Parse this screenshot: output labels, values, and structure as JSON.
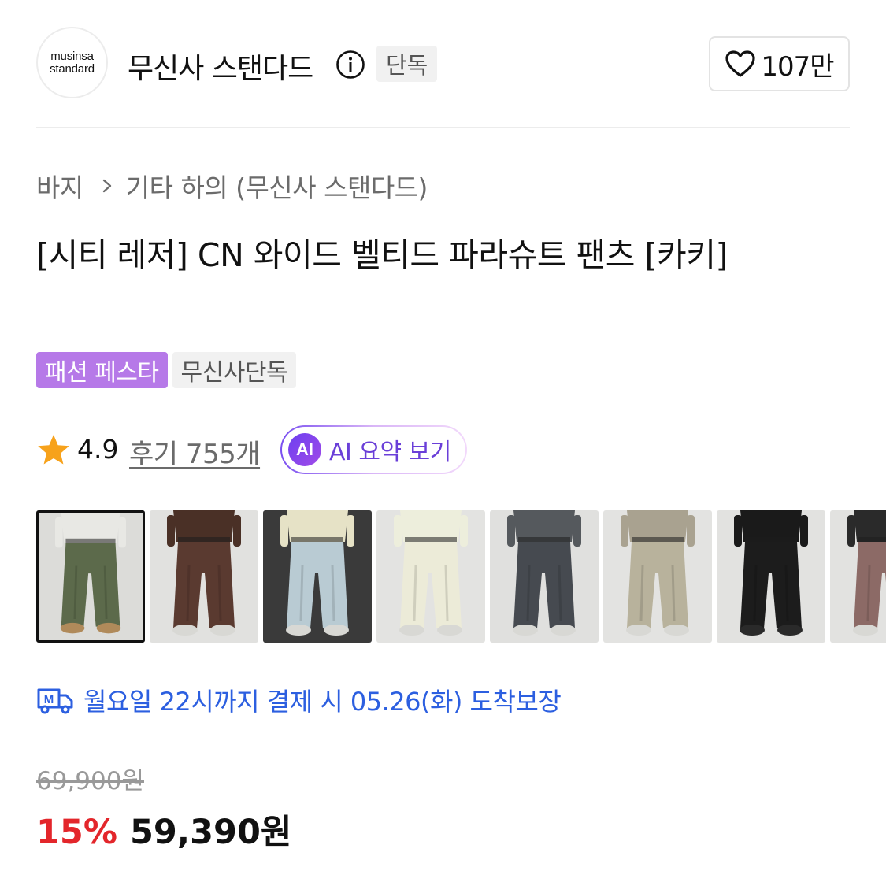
{
  "brand": {
    "logo_line1": "musinsa",
    "logo_line2": "standard",
    "name": "무신사 스탠다드",
    "exclusive_chip": "단독",
    "likes": "107만"
  },
  "breadcrumb": {
    "category": "바지",
    "subcategory": "기타 하의 (무신사 스탠다드)"
  },
  "product": {
    "title": "[시티 레저] CN 와이드 벨티드 파라슈트 팬츠 [카키]",
    "tags": [
      "패션 페스타",
      "무신사단독"
    ],
    "rating": "4.9",
    "reviews": "후기 755개",
    "ai_badge": "AI",
    "ai_summary_label": "AI 요약 보기"
  },
  "thumbnails": [
    {
      "name": "khaki",
      "pants_color": "#5c6a4b",
      "top_color": "#e8e8e4",
      "bg": "#dcdcd9",
      "selected": true
    },
    {
      "name": "brown",
      "pants_color": "#5a3a30",
      "top_color": "#4a3026",
      "bg": "#e1e1df",
      "selected": false
    },
    {
      "name": "light-blue",
      "pants_color": "#b9cbd3",
      "top_color": "#e6e2c6",
      "bg": "#3a3a3a",
      "selected": false
    },
    {
      "name": "ivory",
      "pants_color": "#ecebd8",
      "top_color": "#edeedc",
      "bg": "#e3e3e1",
      "selected": false
    },
    {
      "name": "charcoal",
      "pants_color": "#464a50",
      "top_color": "#55595d",
      "bg": "#e0e0de",
      "selected": false
    },
    {
      "name": "beige",
      "pants_color": "#b8b29c",
      "top_color": "#a9a290",
      "bg": "#e3e3e1",
      "selected": false
    },
    {
      "name": "black",
      "pants_color": "#1c1c1c",
      "top_color": "#1a1a1a",
      "bg": "#e2e2e0",
      "selected": false
    },
    {
      "name": "mauve",
      "pants_color": "#8c6a66",
      "top_color": "#2a2a2a",
      "bg": "#e2e2e0",
      "selected": false
    }
  ],
  "delivery": {
    "text": "월요일 22시까지 결제 시 05.26(화) 도착보장",
    "color": "#2c5fe0"
  },
  "price": {
    "original": "69,900원",
    "discount": "15%",
    "sale": "59,390원"
  },
  "colors": {
    "accent_purple": "#b679e8",
    "discount_red": "#e3262b"
  }
}
